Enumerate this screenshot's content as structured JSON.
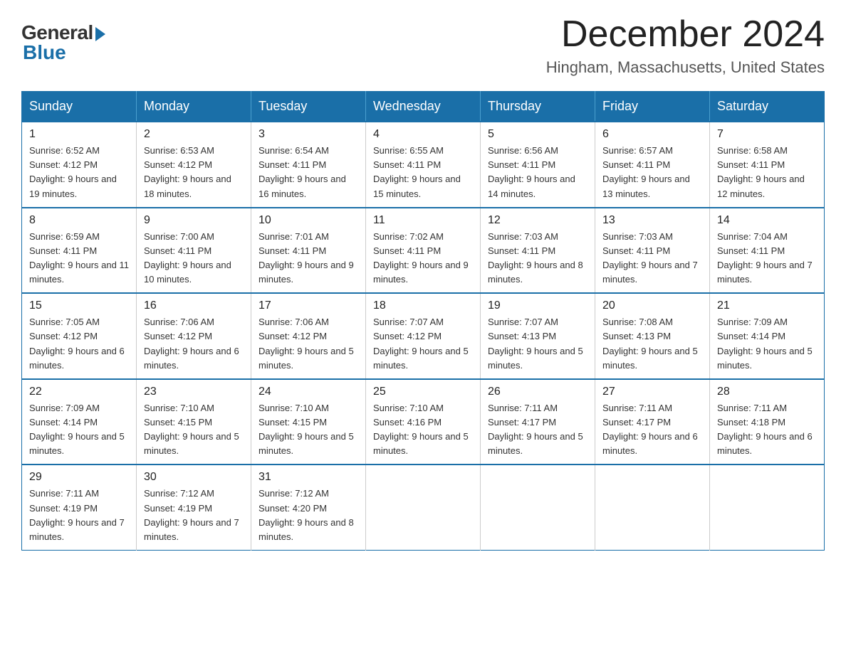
{
  "header": {
    "logo_general": "General",
    "logo_blue": "Blue",
    "title": "December 2024",
    "subtitle": "Hingham, Massachusetts, United States"
  },
  "days_of_week": [
    "Sunday",
    "Monday",
    "Tuesday",
    "Wednesday",
    "Thursday",
    "Friday",
    "Saturday"
  ],
  "weeks": [
    [
      {
        "day": "1",
        "sunrise": "6:52 AM",
        "sunset": "4:12 PM",
        "daylight": "9 hours and 19 minutes."
      },
      {
        "day": "2",
        "sunrise": "6:53 AM",
        "sunset": "4:12 PM",
        "daylight": "9 hours and 18 minutes."
      },
      {
        "day": "3",
        "sunrise": "6:54 AM",
        "sunset": "4:11 PM",
        "daylight": "9 hours and 16 minutes."
      },
      {
        "day": "4",
        "sunrise": "6:55 AM",
        "sunset": "4:11 PM",
        "daylight": "9 hours and 15 minutes."
      },
      {
        "day": "5",
        "sunrise": "6:56 AM",
        "sunset": "4:11 PM",
        "daylight": "9 hours and 14 minutes."
      },
      {
        "day": "6",
        "sunrise": "6:57 AM",
        "sunset": "4:11 PM",
        "daylight": "9 hours and 13 minutes."
      },
      {
        "day": "7",
        "sunrise": "6:58 AM",
        "sunset": "4:11 PM",
        "daylight": "9 hours and 12 minutes."
      }
    ],
    [
      {
        "day": "8",
        "sunrise": "6:59 AM",
        "sunset": "4:11 PM",
        "daylight": "9 hours and 11 minutes."
      },
      {
        "day": "9",
        "sunrise": "7:00 AM",
        "sunset": "4:11 PM",
        "daylight": "9 hours and 10 minutes."
      },
      {
        "day": "10",
        "sunrise": "7:01 AM",
        "sunset": "4:11 PM",
        "daylight": "9 hours and 9 minutes."
      },
      {
        "day": "11",
        "sunrise": "7:02 AM",
        "sunset": "4:11 PM",
        "daylight": "9 hours and 9 minutes."
      },
      {
        "day": "12",
        "sunrise": "7:03 AM",
        "sunset": "4:11 PM",
        "daylight": "9 hours and 8 minutes."
      },
      {
        "day": "13",
        "sunrise": "7:03 AM",
        "sunset": "4:11 PM",
        "daylight": "9 hours and 7 minutes."
      },
      {
        "day": "14",
        "sunrise": "7:04 AM",
        "sunset": "4:11 PM",
        "daylight": "9 hours and 7 minutes."
      }
    ],
    [
      {
        "day": "15",
        "sunrise": "7:05 AM",
        "sunset": "4:12 PM",
        "daylight": "9 hours and 6 minutes."
      },
      {
        "day": "16",
        "sunrise": "7:06 AM",
        "sunset": "4:12 PM",
        "daylight": "9 hours and 6 minutes."
      },
      {
        "day": "17",
        "sunrise": "7:06 AM",
        "sunset": "4:12 PM",
        "daylight": "9 hours and 5 minutes."
      },
      {
        "day": "18",
        "sunrise": "7:07 AM",
        "sunset": "4:12 PM",
        "daylight": "9 hours and 5 minutes."
      },
      {
        "day": "19",
        "sunrise": "7:07 AM",
        "sunset": "4:13 PM",
        "daylight": "9 hours and 5 minutes."
      },
      {
        "day": "20",
        "sunrise": "7:08 AM",
        "sunset": "4:13 PM",
        "daylight": "9 hours and 5 minutes."
      },
      {
        "day": "21",
        "sunrise": "7:09 AM",
        "sunset": "4:14 PM",
        "daylight": "9 hours and 5 minutes."
      }
    ],
    [
      {
        "day": "22",
        "sunrise": "7:09 AM",
        "sunset": "4:14 PM",
        "daylight": "9 hours and 5 minutes."
      },
      {
        "day": "23",
        "sunrise": "7:10 AM",
        "sunset": "4:15 PM",
        "daylight": "9 hours and 5 minutes."
      },
      {
        "day": "24",
        "sunrise": "7:10 AM",
        "sunset": "4:15 PM",
        "daylight": "9 hours and 5 minutes."
      },
      {
        "day": "25",
        "sunrise": "7:10 AM",
        "sunset": "4:16 PM",
        "daylight": "9 hours and 5 minutes."
      },
      {
        "day": "26",
        "sunrise": "7:11 AM",
        "sunset": "4:17 PM",
        "daylight": "9 hours and 5 minutes."
      },
      {
        "day": "27",
        "sunrise": "7:11 AM",
        "sunset": "4:17 PM",
        "daylight": "9 hours and 6 minutes."
      },
      {
        "day": "28",
        "sunrise": "7:11 AM",
        "sunset": "4:18 PM",
        "daylight": "9 hours and 6 minutes."
      }
    ],
    [
      {
        "day": "29",
        "sunrise": "7:11 AM",
        "sunset": "4:19 PM",
        "daylight": "9 hours and 7 minutes."
      },
      {
        "day": "30",
        "sunrise": "7:12 AM",
        "sunset": "4:19 PM",
        "daylight": "9 hours and 7 minutes."
      },
      {
        "day": "31",
        "sunrise": "7:12 AM",
        "sunset": "4:20 PM",
        "daylight": "9 hours and 8 minutes."
      },
      null,
      null,
      null,
      null
    ]
  ]
}
